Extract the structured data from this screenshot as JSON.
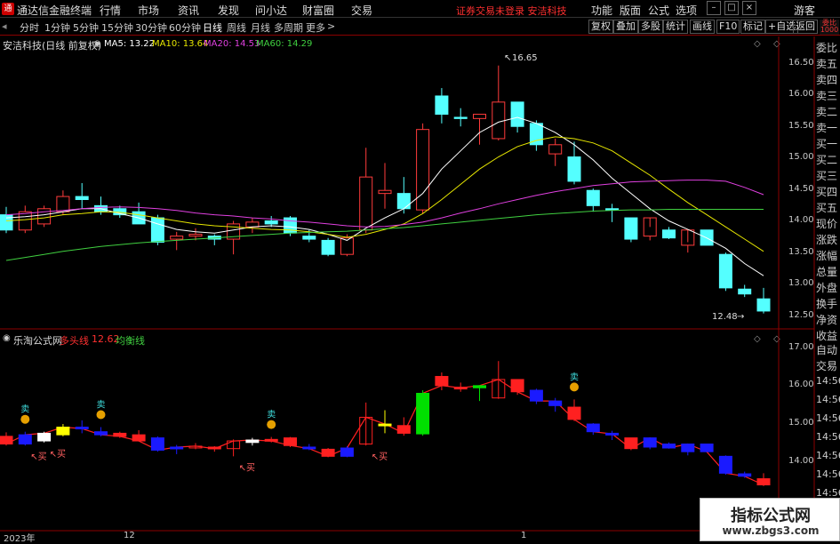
{
  "app": {
    "title": "通达信金融终端",
    "logo_glyph": "通"
  },
  "menu": [
    "行情",
    "市场",
    "资讯",
    "发现",
    "问小达",
    "财富圈",
    "交易"
  ],
  "warning": "证券交易未登录 安洁科技",
  "right_menu": [
    "功能",
    "版面",
    "公式",
    "选项"
  ],
  "guest": "游客",
  "timeframes": [
    "分时",
    "1分钟",
    "5分钟",
    "15分钟",
    "30分钟",
    "60分钟",
    "日线",
    "周线",
    "月线",
    "多周期",
    "更多"
  ],
  "active_timeframe": "日线",
  "toolbar_buttons": [
    "复权",
    "叠加",
    "多股",
    "统计",
    "画线",
    "F10",
    "标记",
    "+自选",
    "返回"
  ],
  "chart_header": {
    "title": "安洁科技(日线 前复权)",
    "ma": [
      {
        "label": "MA5: 13.22",
        "color": "#ffffff"
      },
      {
        "label": "MA10: 13.64",
        "color": "#e6e600"
      },
      {
        "label": "MA20: 14.53",
        "color": "#e040e0"
      },
      {
        "label": "MA60: 14.29",
        "color": "#40d040"
      }
    ]
  },
  "indicator_header": {
    "name": "乐淘公式网",
    "line1": "多头线",
    "value": "12.62",
    "line2": "均衡线"
  },
  "chart_data": [
    {
      "type": "candlestick",
      "name": "main",
      "yticks": [
        "16.50",
        "16.00",
        "15.50",
        "15.00",
        "14.50",
        "14.00",
        "13.50",
        "13.00",
        "12.50"
      ],
      "ylim": [
        12.4,
        16.85
      ],
      "high_label": "16.65",
      "low_label": "12.48",
      "candles": [
        {
          "o": 14.2,
          "h": 14.33,
          "l": 13.9,
          "c": 13.95
        },
        {
          "o": 13.95,
          "h": 14.35,
          "l": 13.9,
          "c": 14.25
        },
        {
          "o": 14.05,
          "h": 14.35,
          "l": 14.0,
          "c": 14.3
        },
        {
          "o": 14.25,
          "h": 14.6,
          "l": 14.2,
          "c": 14.5
        },
        {
          "o": 14.5,
          "h": 14.72,
          "l": 14.3,
          "c": 14.45
        },
        {
          "o": 14.35,
          "h": 14.5,
          "l": 14.2,
          "c": 14.25
        },
        {
          "o": 14.3,
          "h": 14.35,
          "l": 14.15,
          "c": 14.2
        },
        {
          "o": 14.25,
          "h": 14.4,
          "l": 14.1,
          "c": 14.05
        },
        {
          "o": 14.15,
          "h": 14.2,
          "l": 13.7,
          "c": 13.75
        },
        {
          "o": 13.8,
          "h": 13.92,
          "l": 13.62,
          "c": 13.85
        },
        {
          "o": 13.85,
          "h": 13.98,
          "l": 13.78,
          "c": 13.88
        },
        {
          "o": 13.85,
          "h": 13.88,
          "l": 13.7,
          "c": 13.8
        },
        {
          "o": 13.8,
          "h": 14.1,
          "l": 13.55,
          "c": 14.05
        },
        {
          "o": 14.0,
          "h": 14.15,
          "l": 13.9,
          "c": 14.08
        },
        {
          "o": 14.1,
          "h": 14.18,
          "l": 14.0,
          "c": 14.05
        },
        {
          "o": 14.15,
          "h": 14.18,
          "l": 13.85,
          "c": 13.9
        },
        {
          "o": 13.85,
          "h": 13.95,
          "l": 13.75,
          "c": 13.8
        },
        {
          "o": 13.78,
          "h": 13.82,
          "l": 13.52,
          "c": 13.55
        },
        {
          "o": 13.55,
          "h": 13.88,
          "l": 13.52,
          "c": 13.82
        },
        {
          "o": 13.95,
          "h": 15.3,
          "l": 13.9,
          "c": 14.82
        },
        {
          "o": 14.55,
          "h": 15.05,
          "l": 14.3,
          "c": 14.6
        },
        {
          "o": 14.55,
          "h": 14.82,
          "l": 14.22,
          "c": 14.3
        },
        {
          "o": 14.28,
          "h": 15.7,
          "l": 14.22,
          "c": 15.6
        },
        {
          "o": 16.15,
          "h": 16.28,
          "l": 15.7,
          "c": 15.85
        },
        {
          "o": 15.8,
          "h": 15.95,
          "l": 15.65,
          "c": 15.78
        },
        {
          "o": 15.78,
          "h": 15.85,
          "l": 15.35,
          "c": 15.85
        },
        {
          "o": 15.45,
          "h": 16.65,
          "l": 15.42,
          "c": 16.05
        },
        {
          "o": 16.05,
          "h": 16.05,
          "l": 15.55,
          "c": 15.65
        },
        {
          "o": 15.7,
          "h": 15.75,
          "l": 15.25,
          "c": 15.35
        },
        {
          "o": 15.2,
          "h": 15.45,
          "l": 15.0,
          "c": 15.35
        },
        {
          "o": 15.15,
          "h": 15.4,
          "l": 14.7,
          "c": 14.75
        },
        {
          "o": 14.6,
          "h": 14.63,
          "l": 14.25,
          "c": 14.35
        },
        {
          "o": 14.3,
          "h": 14.38,
          "l": 14.08,
          "c": 14.28
        },
        {
          "o": 14.15,
          "h": 14.15,
          "l": 13.75,
          "c": 13.8
        },
        {
          "o": 13.85,
          "h": 14.0,
          "l": 13.78,
          "c": 14.15
        },
        {
          "o": 13.95,
          "h": 14.0,
          "l": 13.8,
          "c": 13.82
        },
        {
          "o": 13.7,
          "h": 13.75,
          "l": 13.58,
          "c": 13.95
        },
        {
          "o": 13.95,
          "h": 13.95,
          "l": 13.7,
          "c": 13.7
        },
        {
          "o": 13.55,
          "h": 13.58,
          "l": 12.95,
          "c": 13.0
        },
        {
          "o": 12.98,
          "h": 13.05,
          "l": 12.85,
          "c": 12.9
        },
        {
          "o": 12.82,
          "h": 13.0,
          "l": 12.58,
          "c": 12.62
        }
      ],
      "ma_series": [
        {
          "name": "MA5",
          "color": "#ffffff",
          "values": [
            14.15,
            14.17,
            14.2,
            14.25,
            14.3,
            14.3,
            14.22,
            14.15,
            14.05,
            13.96,
            13.92,
            13.9,
            13.95,
            14.0,
            14.02,
            14.0,
            13.96,
            13.88,
            13.78,
            13.98,
            14.15,
            14.3,
            14.55,
            14.95,
            15.25,
            15.55,
            15.72,
            15.8,
            15.7,
            15.55,
            15.35,
            15.1,
            14.8,
            14.55,
            14.3,
            14.1,
            13.96,
            13.82,
            13.65,
            13.4,
            13.2
          ]
        },
        {
          "name": "MA10",
          "color": "#e6e600",
          "values": [
            14.1,
            14.12,
            14.15,
            14.2,
            14.22,
            14.25,
            14.24,
            14.2,
            14.15,
            14.1,
            14.05,
            14.02,
            14.0,
            13.98,
            13.96,
            13.95,
            13.92,
            13.88,
            13.83,
            13.88,
            13.96,
            14.05,
            14.22,
            14.45,
            14.7,
            14.95,
            15.15,
            15.32,
            15.42,
            15.48,
            15.45,
            15.38,
            15.25,
            15.05,
            14.85,
            14.62,
            14.4,
            14.2,
            14.0,
            13.8,
            13.6
          ]
        },
        {
          "name": "MA20",
          "color": "#e040e0",
          "values": [
            14.2,
            14.22,
            14.25,
            14.27,
            14.3,
            14.32,
            14.33,
            14.32,
            14.3,
            14.27,
            14.23,
            14.2,
            14.18,
            14.15,
            14.13,
            14.1,
            14.08,
            14.05,
            14.02,
            14.0,
            14.01,
            14.04,
            14.08,
            14.15,
            14.23,
            14.3,
            14.38,
            14.45,
            14.52,
            14.58,
            14.63,
            14.68,
            14.71,
            14.74,
            14.75,
            14.76,
            14.77,
            14.77,
            14.75,
            14.65,
            14.53
          ]
        },
        {
          "name": "MA60",
          "color": "#40d040",
          "values": [
            13.45,
            13.5,
            13.55,
            13.6,
            13.64,
            13.68,
            13.71,
            13.74,
            13.76,
            13.78,
            13.8,
            13.82,
            13.84,
            13.86,
            13.88,
            13.9,
            13.91,
            13.92,
            13.93,
            13.95,
            13.97,
            13.99,
            14.02,
            14.05,
            14.08,
            14.11,
            14.14,
            14.17,
            14.2,
            14.22,
            14.24,
            14.26,
            14.27,
            14.28,
            14.28,
            14.29,
            14.29,
            14.29,
            14.29,
            14.29,
            14.29
          ]
        }
      ]
    },
    {
      "type": "candlestick",
      "name": "indicator",
      "yticks": [
        "17.00",
        "16.00",
        "15.00",
        "14.00"
      ],
      "ylim": [
        12.2,
        17.35
      ],
      "colors": [
        "red",
        "blue",
        "white",
        "yellow",
        "blue",
        "blue",
        "red",
        "red",
        "blue",
        "blue",
        "red",
        "red",
        "red",
        "white",
        "red",
        "red",
        "blue",
        "red",
        "blue",
        "red",
        "yellow",
        "red",
        "green",
        "red",
        "red",
        "green",
        "red",
        "red",
        "blue",
        "blue",
        "red",
        "blue",
        "blue",
        "red",
        "blue",
        "blue",
        "blue",
        "blue",
        "blue",
        "blue",
        "red"
      ],
      "signals": [
        {
          "index": 1,
          "type": "sell",
          "label": "卖"
        },
        {
          "index": 1,
          "type": "buy",
          "label": "买"
        },
        {
          "index": 2,
          "type": "buy",
          "label": "买"
        },
        {
          "index": 5,
          "type": "sell",
          "label": "卖"
        },
        {
          "index": 12,
          "type": "buy",
          "label": "买"
        },
        {
          "index": 14,
          "type": "sell",
          "label": "卖"
        },
        {
          "index": 19,
          "type": "buy",
          "label": "买"
        },
        {
          "index": 30,
          "type": "sell",
          "label": "卖"
        }
      ]
    }
  ],
  "right_panel": {
    "quote_labels": [
      "委比",
      "卖五",
      "卖四",
      "卖三",
      "卖二",
      "卖一",
      "买一",
      "买二",
      "买三",
      "买四",
      "买五",
      "现价",
      "涨跌",
      "涨幅",
      "总量",
      "外盘",
      "换手",
      "净资",
      "收益"
    ],
    "auto_trade_labels": [
      "自动",
      "交易"
    ],
    "times": [
      "14:56",
      "14:56",
      "14:56",
      "14:56",
      "14:56",
      "14:56",
      "14:56",
      "14:56"
    ],
    "corner_labels": [
      "委比",
      "1000"
    ]
  },
  "date_axis": [
    "2023年",
    "12",
    "1"
  ],
  "watermark": {
    "line1": "指标公式网",
    "line2": "www.zbgs3.com"
  }
}
